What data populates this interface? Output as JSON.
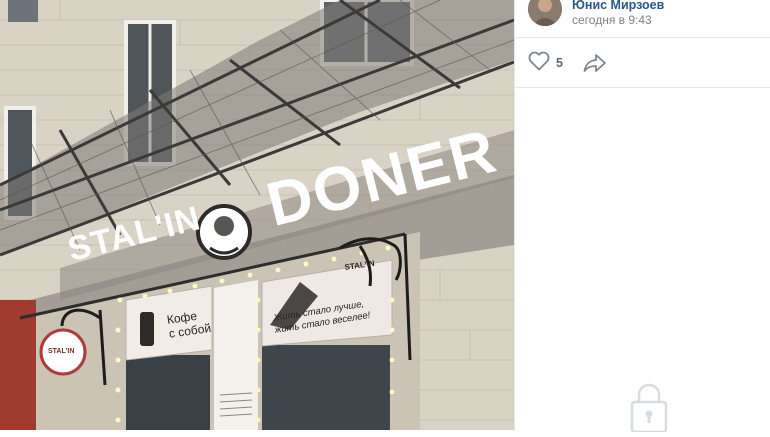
{
  "author": {
    "name": "Юнис Мирзоев",
    "time": "сегодня в 9:43",
    "avatar_icon": "avatar"
  },
  "actions": {
    "like_icon": "heart-icon",
    "like_count": "5",
    "share_icon": "share-arrow-icon"
  },
  "photo": {
    "sign_main": "DONER",
    "sign_prefix": "STAL'IN",
    "menu_left": "Кофе\nс собой",
    "menu_right_line1": "Жить стало лучше,",
    "menu_right_line2": "жить стало веселее!",
    "menu_right_brand": "STAL'IN",
    "round_sign": "STAL'IN"
  },
  "colors": {
    "link": "#2a5885",
    "muted": "#828282",
    "icon": "#7c8792",
    "divider": "#e7e8ec",
    "facade": "#d9d3c6",
    "sign_board": "#9a9590",
    "sign_text": "#ffffff"
  },
  "lock_icon": "lock-icon"
}
